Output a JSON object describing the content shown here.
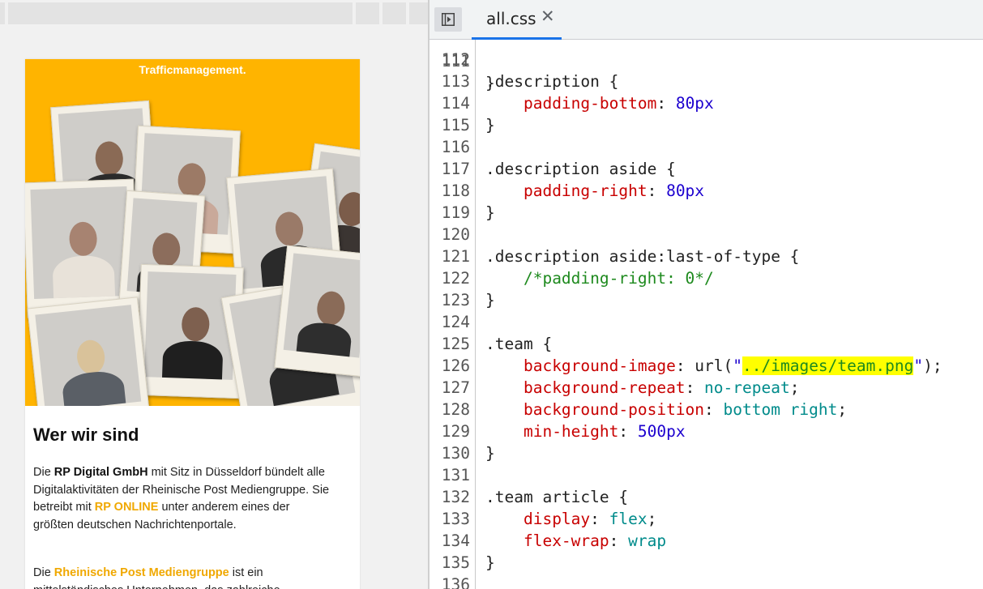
{
  "preview": {
    "hero_title": "Trafficmanagement.",
    "section_heading": "Wer wir sind",
    "para1": {
      "t1": "Die ",
      "b1": "RP Digital GmbH",
      "t2": " mit Sitz in Düsseldorf bündelt alle Digitalaktivitäten der Rheinische Post Mediengruppe. Sie betreibt mit ",
      "link1": "RP ONLINE",
      "t3": " unter anderem eines der größten deutschen Nachrichtenportale."
    },
    "para2": {
      "t1": "Die ",
      "link1": "Rheinische Post Mediengruppe",
      "t2": " ist ein mittelständisches Unternehmen, das zahlreiche"
    },
    "colors": {
      "hero_bg": "#ffb400",
      "link": "#f0a800"
    }
  },
  "editor": {
    "tab_label": "all.css",
    "close_icon": "✕",
    "panel_toggle_icon": "sidebar-toggle-icon",
    "first_line_partial": "111",
    "lines": [
      {
        "num": "112",
        "html": ""
      },
      {
        "num": "113",
        "html": "<span class=\"t-sel\">.description {</span>"
      },
      {
        "num": "114",
        "html": "    <span class=\"t-prop\">padding-bottom</span>: <span class=\"t-num\">80px</span>"
      },
      {
        "num": "115",
        "html": "}"
      },
      {
        "num": "116",
        "html": ""
      },
      {
        "num": "117",
        "html": "<span class=\"t-sel\">.description aside {</span>"
      },
      {
        "num": "118",
        "html": "    <span class=\"t-prop\">padding-right</span>: <span class=\"t-num\">80px</span>"
      },
      {
        "num": "119",
        "html": "}"
      },
      {
        "num": "120",
        "html": ""
      },
      {
        "num": "121",
        "html": "<span class=\"t-sel\">.description aside:last-of-type {</span>"
      },
      {
        "num": "122",
        "html": "    <span class=\"t-com\">/*padding-right: 0*/</span>"
      },
      {
        "num": "123",
        "html": "}"
      },
      {
        "num": "124",
        "html": ""
      },
      {
        "num": "125",
        "html": "<span class=\"t-sel\">.team {</span>"
      },
      {
        "num": "126",
        "html": "    <span class=\"t-prop\">background-image</span>: url(<span class=\"t-str\">\"</span><span class=\"hl\">../images/team.png</span><span class=\"t-str\">\"</span>);"
      },
      {
        "num": "127",
        "html": "    <span class=\"t-prop\">background-repeat</span>: <span class=\"t-kw\">no-repeat</span>;"
      },
      {
        "num": "128",
        "html": "    <span class=\"t-prop\">background-position</span>: <span class=\"t-kw\">bottom right</span>;"
      },
      {
        "num": "129",
        "html": "    <span class=\"t-prop\">min-height</span>: <span class=\"t-num\">500px</span>"
      },
      {
        "num": "130",
        "html": "}"
      },
      {
        "num": "131",
        "html": ""
      },
      {
        "num": "132",
        "html": "<span class=\"t-sel\">.team article {</span>"
      },
      {
        "num": "133",
        "html": "    <span class=\"t-prop\">display</span>: <span class=\"t-kw\">flex</span>;"
      },
      {
        "num": "134",
        "html": "    <span class=\"t-prop\">flex-wrap</span>: <span class=\"t-kw\">wrap</span>"
      },
      {
        "num": "135",
        "html": "}"
      },
      {
        "num": "136",
        "html": ""
      }
    ],
    "highlight_color": "#ffff00"
  }
}
